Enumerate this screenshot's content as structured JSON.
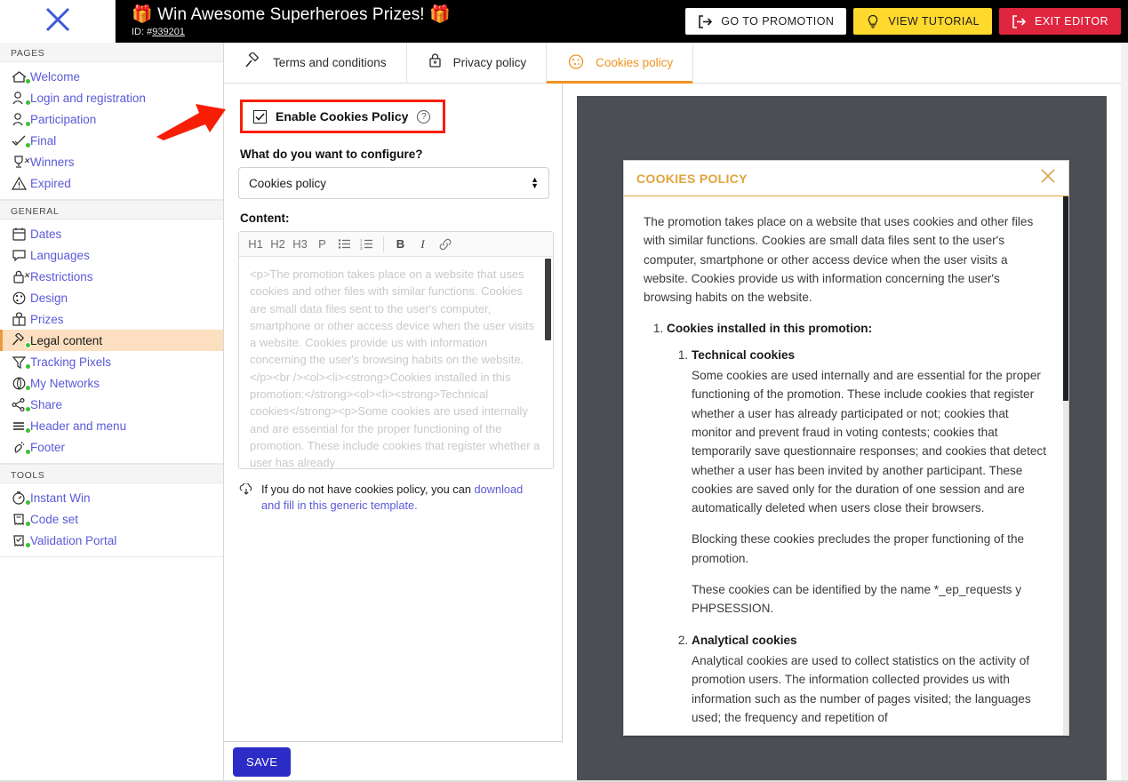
{
  "topbar": {
    "close_icon": "close-x-icon",
    "title": "🎁 Win Awesome Superheroes Prizes! 🎁",
    "id_prefix": "ID: #",
    "id_value": "939201",
    "buttons": [
      {
        "label": "GO TO PROMOTION",
        "icon": "exit-arrow-icon",
        "style": "white"
      },
      {
        "label": "VIEW TUTORIAL",
        "icon": "lightbulb-icon",
        "style": "yellow"
      },
      {
        "label": "EXIT EDITOR",
        "icon": "exit-arrow-icon",
        "style": "red"
      }
    ]
  },
  "sidebar": {
    "sections": [
      {
        "heading": "PAGES",
        "items": [
          {
            "label": "Welcome",
            "icon": "home-icon",
            "status": "green"
          },
          {
            "label": "Login and registration",
            "icon": "user-key-icon",
            "status": "green"
          },
          {
            "label": "Participation",
            "icon": "user-edit-icon",
            "status": "green"
          },
          {
            "label": "Final",
            "icon": "check-icon",
            "status": "green"
          },
          {
            "label": "Winners",
            "icon": "trophy-icon",
            "status": "x"
          },
          {
            "label": "Expired",
            "icon": "warning-icon",
            "status": "none"
          }
        ]
      },
      {
        "heading": "GENERAL",
        "items": [
          {
            "label": "Dates",
            "icon": "calendar-icon",
            "status": "none"
          },
          {
            "label": "Languages",
            "icon": "speech-bubble-icon",
            "status": "none"
          },
          {
            "label": "Restrictions",
            "icon": "lock-icon",
            "status": "x"
          },
          {
            "label": "Design",
            "icon": "palette-icon",
            "status": "none"
          },
          {
            "label": "Prizes",
            "icon": "gift-icon",
            "status": "none"
          },
          {
            "label": "Legal content",
            "icon": "gavel-icon",
            "status": "green",
            "active": true
          },
          {
            "label": "Tracking Pixels",
            "icon": "funnel-icon",
            "status": "green"
          },
          {
            "label": "My Networks",
            "icon": "network-icon",
            "status": "green"
          },
          {
            "label": "Share",
            "icon": "share-icon",
            "status": "green"
          },
          {
            "label": "Header and menu",
            "icon": "menu-lines-icon",
            "status": "green"
          },
          {
            "label": "Footer",
            "icon": "footprint-icon",
            "status": "green"
          }
        ]
      },
      {
        "heading": "TOOLS",
        "items": [
          {
            "label": "Instant Win",
            "icon": "stopwatch-icon",
            "status": "green"
          },
          {
            "label": "Code set",
            "icon": "ticket-icon",
            "status": "green"
          },
          {
            "label": "Validation Portal",
            "icon": "ticket-check-icon",
            "status": "green"
          }
        ]
      }
    ]
  },
  "tabs": [
    {
      "label": "Terms and conditions",
      "icon": "gavel-icon",
      "active": false
    },
    {
      "label": "Privacy policy",
      "icon": "lock-icon",
      "active": false
    },
    {
      "label": "Cookies policy",
      "icon": "cookie-icon",
      "active": true
    }
  ],
  "editor": {
    "enable_checkbox": {
      "label": "Enable Cookies Policy",
      "checked": true,
      "help_icon": "question-mark-icon"
    },
    "configure_label": "What do you want to configure?",
    "configure_value": "Cookies policy",
    "content_label": "Content:",
    "toolbar_buttons": [
      "H1",
      "H2",
      "H3",
      "P",
      "bulleted-list-icon",
      "numbered-list-icon",
      "B",
      "I",
      "link-icon"
    ],
    "content_placeholder": "<p>The promotion takes place on a website that uses cookies and other files with similar functions. Cookies are small data files sent to the user's computer, smartphone or other access device when the user visits a website. Cookies provide us with information concerning the user's browsing habits on the website.</p><br /><ol><li><strong>Cookies installed in this promotion:</strong><ol><li><strong>Technical cookies</strong><p>Some cookies are used internally and are essential for the proper functioning of the promotion. These include cookies that register whether a user has already",
    "hint_icon": "download-cloud-icon",
    "hint_text": "If you do not have cookies policy, you can ",
    "hint_link": "download and fill in this generic template.",
    "save_label": "SAVE"
  },
  "preview": {
    "modal_title": "COOKIES POLICY",
    "close_icon": "close-x-icon",
    "intro": "The promotion takes place on a website that uses cookies and other files with similar functions. Cookies are small data files sent to the user's computer, smartphone or other access device when the user visits a website. Cookies provide us with information concerning the user's browsing habits on the website.",
    "list_heading": "Cookies installed in this promotion:",
    "items": [
      {
        "title": "Technical cookies",
        "paragraphs": [
          "Some cookies are used internally and are essential for the proper functioning of the promotion. These include cookies that register whether a user has already participated or not; cookies that monitor and prevent fraud in voting contests; cookies that temporarily save questionnaire responses; and cookies that detect whether a user has been invited by another participant. These cookies are saved only for the duration of one session and are automatically deleted when users close their browsers.",
          "Blocking these cookies precludes the proper functioning of the promotion.",
          "These cookies can be identified by the name *_ep_requests y PHPSESSION."
        ]
      },
      {
        "title": "Analytical cookies",
        "paragraphs": [
          "Analytical cookies are used to collect statistics on the activity of promotion users. The information collected provides us with information such as the number of pages visited; the languages used; the frequency and repetition of"
        ]
      }
    ]
  },
  "annotation": {
    "arrow": "red-arrow-pointing-right",
    "highlight_color": "#f81e06"
  }
}
